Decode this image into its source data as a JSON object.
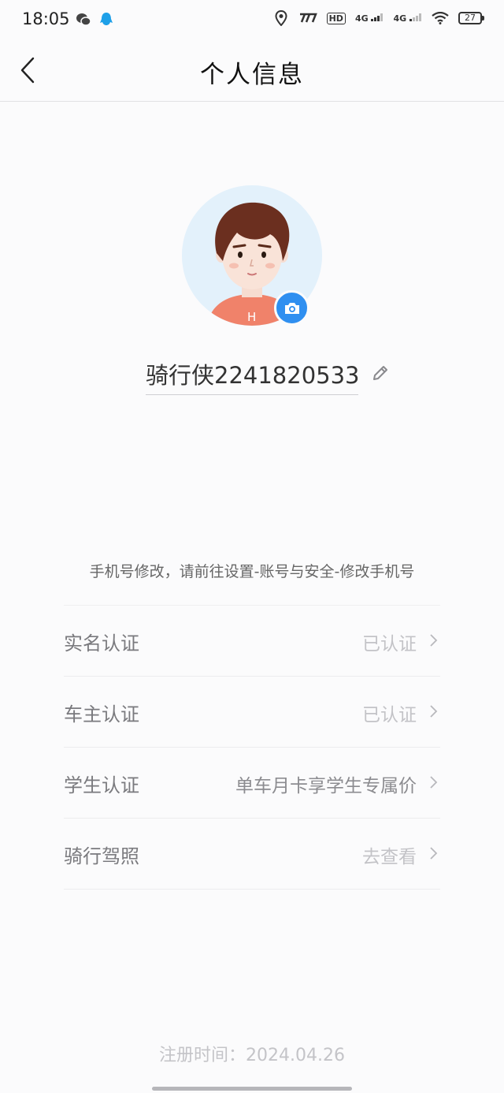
{
  "status_bar": {
    "time": "18:05",
    "hd_badge": "HD",
    "network_1": "4G",
    "network_2": "4G",
    "battery": "27",
    "icons": [
      "wechat-icon",
      "qq-icon",
      "location-icon",
      "speed-icon",
      "wifi-icon",
      "battery-icon"
    ]
  },
  "nav": {
    "title": "个人信息"
  },
  "profile": {
    "nickname": "骑行侠2241820533",
    "avatar_shirt_letter": "H"
  },
  "hint": "手机号修改，请前往设置-账号与安全-修改手机号",
  "rows": [
    {
      "label": "实名认证",
      "value": "已认证"
    },
    {
      "label": "车主认证",
      "value": "已认证"
    },
    {
      "label": "学生认证",
      "value": "单车月卡享学生专属价"
    },
    {
      "label": "骑行驾照",
      "value": "去查看"
    }
  ],
  "footer": {
    "register_time": "注册时间：2024.04.26"
  },
  "colors": {
    "accent": "#2f8ff0",
    "background": "#fbfbfc"
  }
}
